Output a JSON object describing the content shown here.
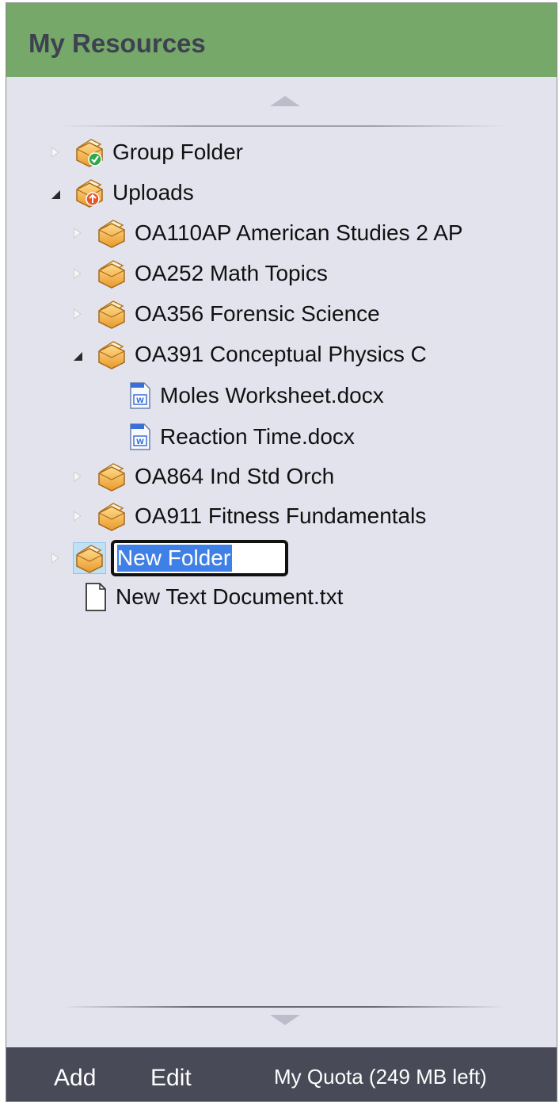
{
  "header": {
    "title": "My Resources"
  },
  "tree": {
    "group_folder": "Group Folder",
    "uploads": "Uploads",
    "oa110": "OA110AP American Studies 2 AP",
    "oa252": "OA252 Math Topics",
    "oa356": "OA356 Forensic Science",
    "oa391": "OA391 Conceptual Physics C",
    "moles": "Moles Worksheet.docx",
    "reaction": "Reaction Time.docx",
    "oa864": "OA864 Ind Std Orch",
    "oa911": "OA911 Fitness Fundamentals",
    "new_folder_value": "New Folder",
    "new_text_doc": "New Text Document.txt"
  },
  "footer": {
    "add_label": "Add",
    "edit_label": "Edit",
    "quota_label": "My Quota (249 MB left)"
  },
  "icons": {
    "collapsed": "triangle-right-icon",
    "expanded": "triangle-down-icon",
    "folder": "folder-icon",
    "shared_folder": "shared-folder-icon",
    "upload_folder": "upload-folder-icon",
    "word_doc": "word-document-icon",
    "text_doc": "text-document-icon"
  },
  "colors": {
    "header_bg": "#76a86a",
    "panel_bg": "#e3e3ee",
    "footer_bg": "#484a57",
    "selection": "#3f80e6"
  }
}
